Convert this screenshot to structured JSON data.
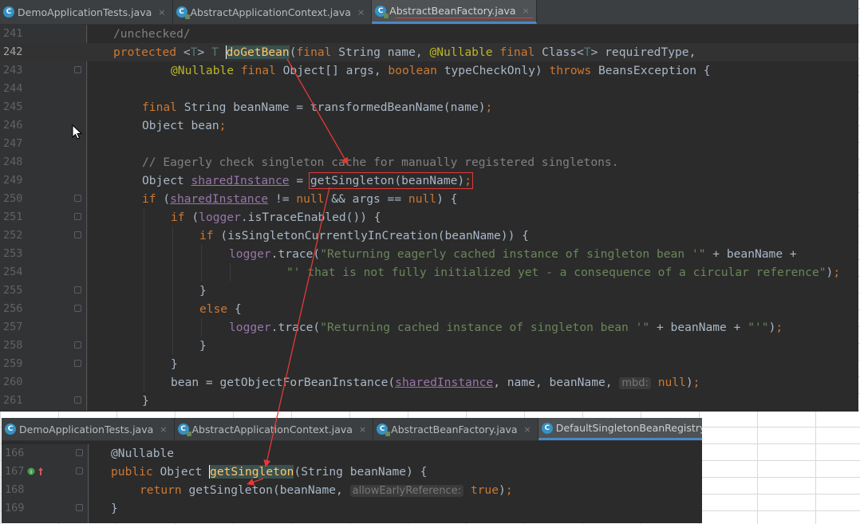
{
  "top_editor": {
    "tabs": [
      {
        "label": "DemoApplicationTests.java",
        "active": false
      },
      {
        "label": "AbstractApplicationContext.java",
        "active": false
      },
      {
        "label": "AbstractBeanFactory.java",
        "active": true
      }
    ],
    "lines": [
      {
        "num": "241",
        "code": "/unchecked/"
      },
      {
        "num": "242",
        "code": "protected <T> T doGetBean(final String name, @Nullable final Class<T> requiredType,"
      },
      {
        "num": "243",
        "code": "@Nullable final Object[] args, boolean typeCheckOnly) throws BeansException {"
      },
      {
        "num": "244",
        "code": ""
      },
      {
        "num": "245",
        "code": "final String beanName = transformedBeanName(name);"
      },
      {
        "num": "246",
        "code": "Object bean;"
      },
      {
        "num": "247",
        "code": ""
      },
      {
        "num": "248",
        "code": "// Eagerly check singleton cache for manually registered singletons."
      },
      {
        "num": "249",
        "code": "Object sharedInstance = getSingleton(beanName);"
      },
      {
        "num": "250",
        "code": "if (sharedInstance != null && args == null) {"
      },
      {
        "num": "251",
        "code": "if (logger.isTraceEnabled()) {"
      },
      {
        "num": "252",
        "code": "if (isSingletonCurrentlyInCreation(beanName)) {"
      },
      {
        "num": "253",
        "code": "logger.trace(\"Returning eagerly cached instance of singleton bean '\" + beanName +"
      },
      {
        "num": "254",
        "code": "\"' that is not fully initialized yet - a consequence of a circular reference\");"
      },
      {
        "num": "255",
        "code": "}"
      },
      {
        "num": "256",
        "code": "else {"
      },
      {
        "num": "257",
        "code": "logger.trace(\"Returning cached instance of singleton bean '\" + beanName + \"'\");"
      },
      {
        "num": "258",
        "code": "}"
      },
      {
        "num": "259",
        "code": "}"
      },
      {
        "num": "260",
        "code": "bean = getObjectForBeanInstance(sharedInstance, name, beanName, mbd: null);"
      },
      {
        "num": "261",
        "code": "}"
      }
    ],
    "hint_mbd": "mbd:"
  },
  "bottom_editor": {
    "tabs": [
      {
        "label": "DemoApplicationTests.java",
        "active": false
      },
      {
        "label": "AbstractApplicationContext.java",
        "active": false
      },
      {
        "label": "AbstractBeanFactory.java",
        "active": false
      },
      {
        "label": "DefaultSingletonBeanRegistry.java",
        "active": true
      }
    ],
    "lines": [
      {
        "num": "166",
        "code": "@Nullable"
      },
      {
        "num": "167",
        "code": "public Object getSingleton(String beanName) {"
      },
      {
        "num": "168",
        "code": "return getSingleton(beanName, allowEarlyReference: true);"
      },
      {
        "num": "169",
        "code": "}"
      }
    ],
    "hint_allow": "allowEarlyReference:"
  },
  "colors": {
    "editor_bg": "#2b2b2b",
    "keyword": "#cc7832",
    "string": "#6a8759",
    "annotation_arrow": "#e53935"
  }
}
